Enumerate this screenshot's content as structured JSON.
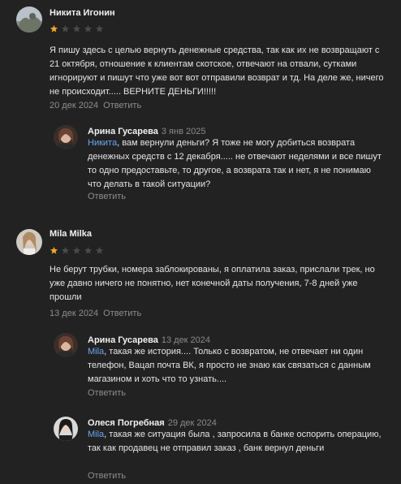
{
  "reply_label": "Ответить",
  "colors": {
    "background": "#222222",
    "star_filled": "#f5a623",
    "star_empty": "#4a4a4a",
    "mention": "#6aa7f0",
    "muted": "#8d8d8d"
  },
  "reviews": [
    {
      "author": "Никита Игонин",
      "rating": 1,
      "text": "Я пишу здесь с целью вернуть денежные средства, так как их не возвращают с 21 октября, отношение к клиентам скотское, отвечают на отвали, сутками игнорируют и пишут что уже вот вот отправили возврат и тд. На деле же, ничего не происходит..... ВЕРНИТЕ ДЕНЬГИ!!!!!",
      "date": "20 дек 2024",
      "replies": [
        {
          "author": "Арина Гусарева",
          "date": "3 янв 2025",
          "mention": "Никита",
          "text": ", вам вернули деньги? Я тоже не могу добиться возврата денежных средств с 12 декабря..... не отвечают неделями и все пишут то одно предоставьте, то другое, а возврата так и нет, я не понимаю что делать в такой ситуации?"
        }
      ]
    },
    {
      "author": "Mila Milka",
      "rating": 1,
      "text": "Не берут трубки, номера заблокированы, я оплатила заказ, прислали трек, но уже давно ничего не понятно, нет конечной даты получения, 7-8 дней уже прошли",
      "date": "13 дек 2024",
      "replies": [
        {
          "author": "Арина Гусарева",
          "date": "13 дек 2024",
          "mention": "Mila",
          "text": ", такая же история.... Только с возвратом, не отвечает ни один телефон, Вацап почта ВК, я просто не знаю как связаться с данным магазином и хоть что то узнать...."
        },
        {
          "author": "Олеся Погребная",
          "date": "29 дек 2024",
          "mention": "Mila",
          "text": ", такая же ситуация была , запросила в банке оспорить операцию, так как продавец не отправил заказ , банк вернул деньги"
        }
      ]
    }
  ]
}
